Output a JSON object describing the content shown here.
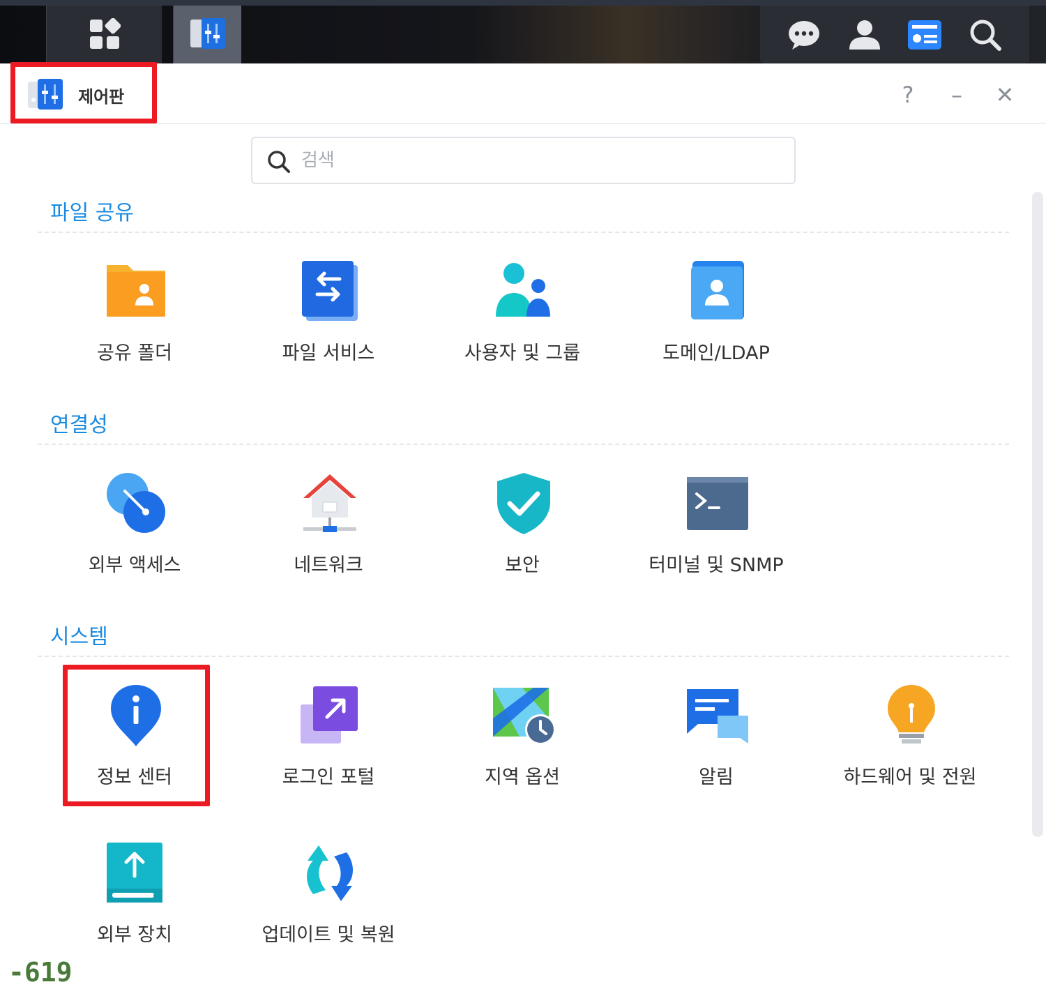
{
  "window": {
    "title": "제어판",
    "help": "?",
    "minimize": "–",
    "close": "✕"
  },
  "search": {
    "placeholder": "검색",
    "value": ""
  },
  "sections": [
    {
      "title": "파일 공유",
      "items": [
        {
          "label": "공유 폴더",
          "icon": "shared-folder-icon"
        },
        {
          "label": "파일 서비스",
          "icon": "file-services-icon"
        },
        {
          "label": "사용자 및 그룹",
          "icon": "user-group-icon"
        },
        {
          "label": "도메인/LDAP",
          "icon": "domain-ldap-icon"
        }
      ]
    },
    {
      "title": "연결성",
      "items": [
        {
          "label": "외부 액세스",
          "icon": "external-access-icon"
        },
        {
          "label": "네트워크",
          "icon": "network-icon"
        },
        {
          "label": "보안",
          "icon": "security-shield-icon"
        },
        {
          "label": "터미널 및 SNMP",
          "icon": "terminal-icon"
        }
      ]
    },
    {
      "title": "시스템",
      "items": [
        {
          "label": "정보 센터",
          "icon": "info-center-icon"
        },
        {
          "label": "로그인 포털",
          "icon": "login-portal-icon"
        },
        {
          "label": "지역 옵션",
          "icon": "regional-options-icon"
        },
        {
          "label": "알림",
          "icon": "notification-icon"
        },
        {
          "label": "하드웨어 및 전원",
          "icon": "hardware-power-icon"
        },
        {
          "label": "외부 장치",
          "icon": "external-devices-icon"
        },
        {
          "label": "업데이트 및 복원",
          "icon": "update-restore-icon"
        }
      ]
    }
  ],
  "overlay": {
    "number": "-619"
  },
  "colors": {
    "accent": "#1a8ae0",
    "highlight": "#ec1b23"
  }
}
